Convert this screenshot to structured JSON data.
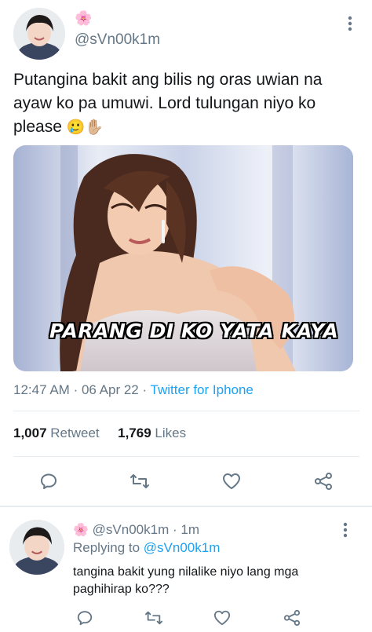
{
  "tweet": {
    "author_badge_emoji": "🌸",
    "handle": "@sVn00k1m",
    "text": "Putangina bakit ang bilis ng oras uwian na ayaw ko pa umuwi. Lord tulungan niyo ko please",
    "text_emojis": "🥲✋🏼",
    "media": {
      "caption": "PARANG DI KO YATA KAYA"
    },
    "time": "12:47 AM",
    "date": "06 Apr 22",
    "source": "Twitter for Iphone",
    "retweet_count": "1,007",
    "retweet_label": "Retweet",
    "like_count": "1,769",
    "like_label": "Likes"
  },
  "reply": {
    "author_badge_emoji": "🌸",
    "handle": "@sVn00k1m",
    "time_ago": "1m",
    "replying_prefix": "Replying to",
    "replying_to": "@sVn00k1m",
    "text": "tangina bakit yung nilalike niyo lang mga paghihirap ko???"
  },
  "icons": {
    "more": "more-vertical-icon",
    "reply": "reply-icon",
    "retweet": "retweet-icon",
    "like": "heart-icon",
    "share": "share-icon"
  }
}
